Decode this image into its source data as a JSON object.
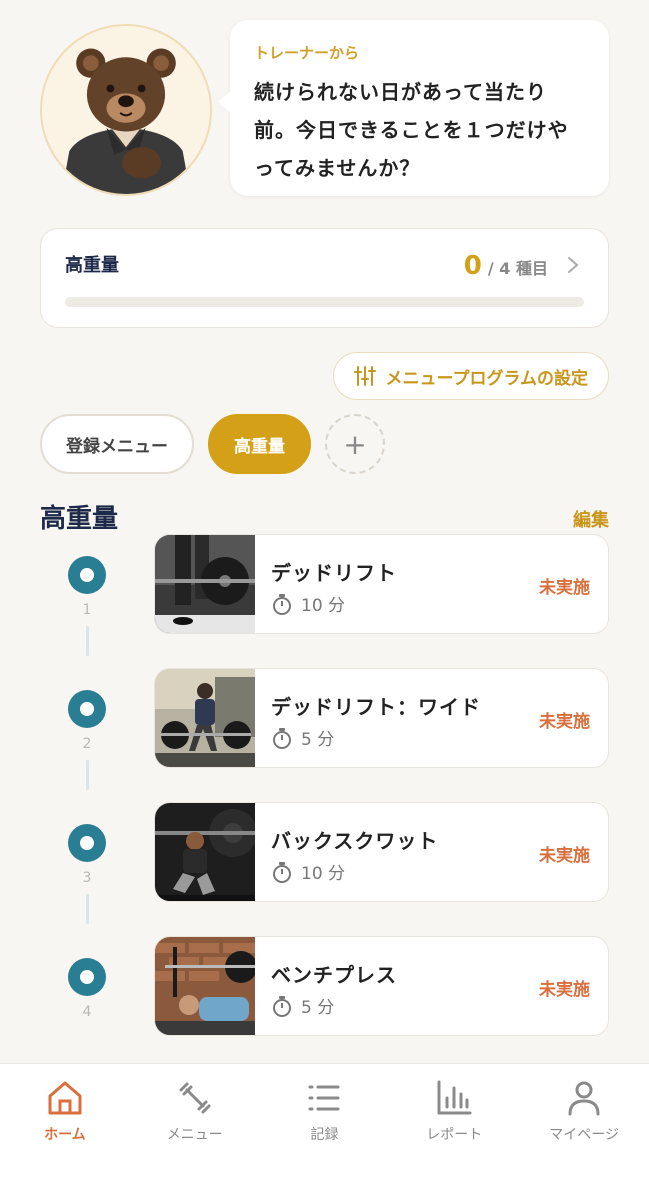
{
  "trainer": {
    "label": "トレーナーから",
    "message_lines": [
      "続けられない日があって当たり",
      "前。今日できることを１つだけや",
      "ってみませんか？"
    ]
  },
  "progress": {
    "title": "高重量",
    "completed": "0",
    "total_text": "/ 4 種目",
    "fraction": 0.0
  },
  "settings_button": {
    "label": "メニュープログラムの設定"
  },
  "menus": {
    "items": [
      {
        "label": "登録メニュー",
        "active": false
      },
      {
        "label": "高重量",
        "active": true
      }
    ],
    "add_label": "+"
  },
  "section": {
    "title": "高重量",
    "edit_label": "編集"
  },
  "exercises": [
    {
      "number": "1",
      "name": "デッドリフト",
      "duration": "10 分",
      "status": "未実施"
    },
    {
      "number": "2",
      "name": "デッドリフト：ワイド",
      "duration": "5 分",
      "status": "未実施"
    },
    {
      "number": "3",
      "name": "バックスクワット",
      "duration": "10 分",
      "status": "未実施"
    },
    {
      "number": "4",
      "name": "ベンチプレス",
      "duration": "5 分",
      "status": "未実施"
    }
  ],
  "nav": {
    "items": [
      {
        "label": "ホーム",
        "icon": "home-icon",
        "active": true
      },
      {
        "label": "メニュー",
        "icon": "dumbbell-icon",
        "active": false
      },
      {
        "label": "記録",
        "icon": "list-icon",
        "active": false
      },
      {
        "label": "レポート",
        "icon": "bar-chart-icon",
        "active": false
      },
      {
        "label": "マイページ",
        "icon": "user-icon",
        "active": false
      }
    ]
  },
  "colors": {
    "accent": "#d4a017",
    "status": "#d86f3d",
    "step": "#2a7e93",
    "navy": "#1e2a4a"
  }
}
